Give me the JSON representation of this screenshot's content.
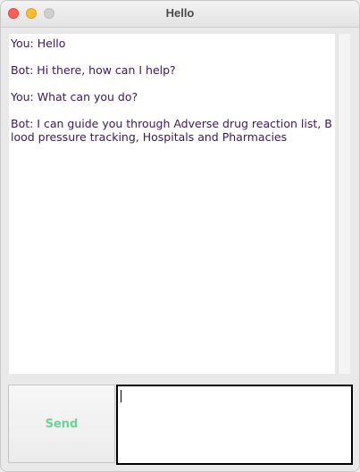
{
  "window": {
    "title": "Hello"
  },
  "chat": {
    "messages": [
      {
        "text": "You: Hello"
      },
      {
        "text": "Bot: Hi there, how can I help?"
      },
      {
        "text": "You: What can you do?"
      },
      {
        "text": "Bot: I can guide you through Adverse drug reaction list, Blood pressure tracking, Hospitals and Pharmacies"
      }
    ]
  },
  "composer": {
    "send_label": "Send",
    "input_value": ""
  },
  "colors": {
    "message_text": "#3b1a5b",
    "send_label": "#6ad39c"
  }
}
